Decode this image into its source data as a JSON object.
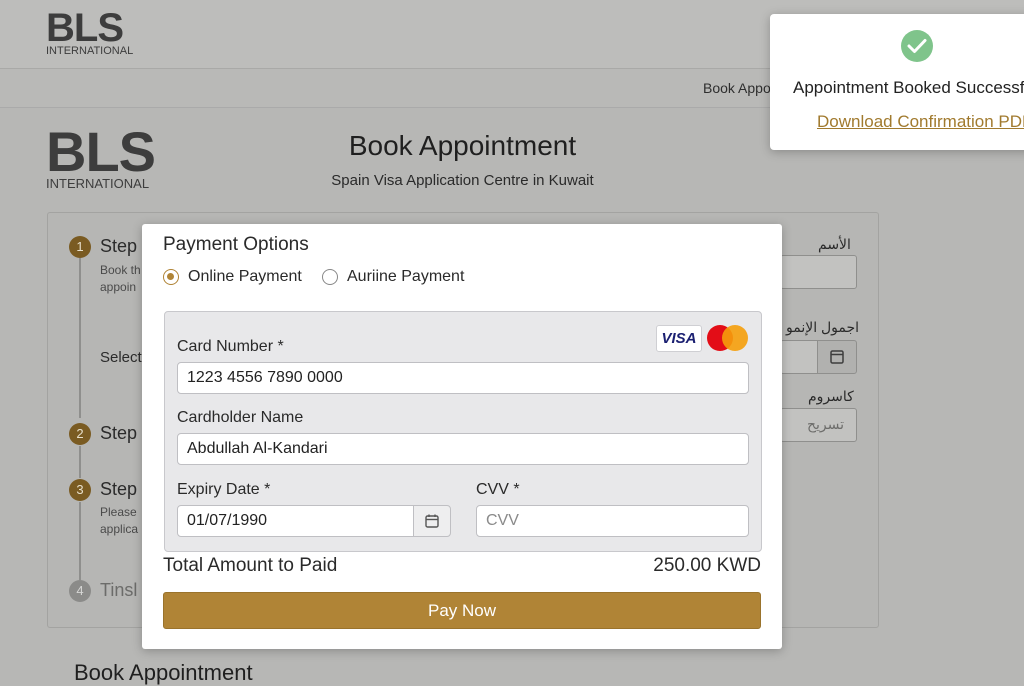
{
  "background": {
    "logo": {
      "mark": "BLS",
      "sub": "INTERNATIONAL"
    },
    "nav": {
      "book_appointment": "Book Appo"
    },
    "title": "Book Appointment",
    "subtitle": "Spain Visa Application Centre in Kuwait",
    "steps": [
      {
        "number": "1",
        "label": "Step",
        "desc": [
          "Book th",
          "appoin"
        ],
        "extra": "Select"
      },
      {
        "number": "2",
        "label": "Step"
      },
      {
        "number": "3",
        "label": "Step",
        "desc": [
          "Please",
          "applica"
        ]
      },
      {
        "number": "4",
        "label": "Tinsl"
      }
    ],
    "arabic": {
      "name_label": "الأسم",
      "date_label": "اجمول الإنمو",
      "field3_label": "كاسروم",
      "field3_placeholder": "تسريح"
    },
    "bottom_title": "Book Appointment"
  },
  "modal": {
    "title": "Payment Options",
    "options": [
      {
        "label": "Online Payment",
        "selected": true
      },
      {
        "label": "Auriine Payment",
        "selected": false
      }
    ],
    "card_brands": {
      "visa": "VISA"
    },
    "fields": {
      "card_number": {
        "label": "Card Number",
        "required": "*",
        "value": "1223 4556 7890 0000"
      },
      "cardholder": {
        "label": "Cardholder Name",
        "value": "Abdullah Al-Kandari"
      },
      "expiry": {
        "label": "Expiry Date",
        "required": "*",
        "value": "01/07/1990"
      },
      "cvv": {
        "label": "CVV",
        "required": "*",
        "placeholder": "CVV"
      }
    },
    "total_label": "Total Amount to Paid",
    "total_value": "250.00 KWD",
    "pay_button": "Pay Now"
  },
  "toast": {
    "message": "Appointment Booked Successful",
    "link": "Download Confirmation PDF"
  },
  "colors": {
    "accent": "#b08436",
    "success": "#7fc48b",
    "overlay": "#b7b7b5"
  }
}
